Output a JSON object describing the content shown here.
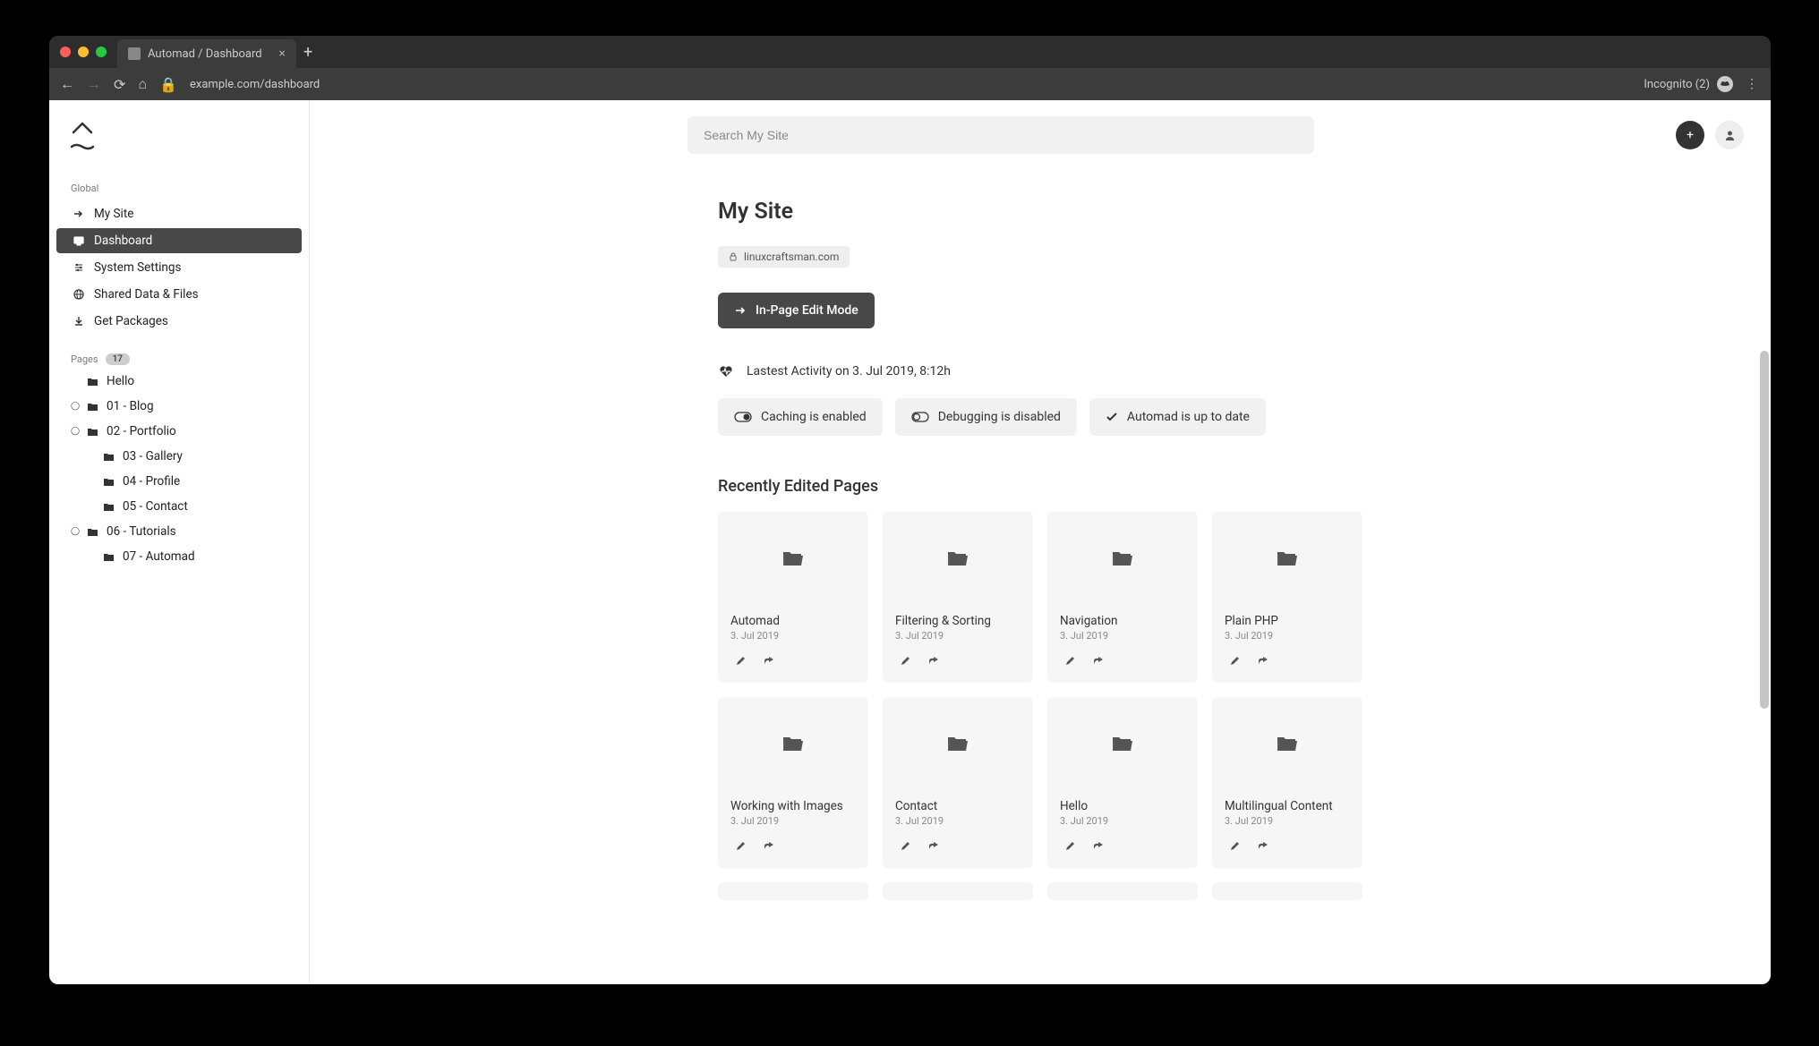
{
  "browser": {
    "tab_title": "Automad / Dashboard",
    "url": "example.com/dashboard",
    "incognito_label": "Incognito (2)"
  },
  "sidebar": {
    "global_label": "Global",
    "items": [
      {
        "icon": "arrow",
        "label": "My Site"
      },
      {
        "icon": "monitor",
        "label": "Dashboard"
      },
      {
        "icon": "sliders",
        "label": "System Settings"
      },
      {
        "icon": "globe",
        "label": "Shared Data & Files"
      },
      {
        "icon": "download",
        "label": "Get Packages"
      }
    ],
    "pages_label": "Pages",
    "pages_count": "17",
    "tree": [
      {
        "depth": 1,
        "expand": false,
        "label": "Hello"
      },
      {
        "depth": 1,
        "expand": true,
        "label": "01 - Blog"
      },
      {
        "depth": 1,
        "expand": true,
        "label": "02 - Portfolio"
      },
      {
        "depth": 2,
        "expand": false,
        "label": "03 - Gallery"
      },
      {
        "depth": 2,
        "expand": false,
        "label": "04 - Profile"
      },
      {
        "depth": 2,
        "expand": false,
        "label": "05 - Contact"
      },
      {
        "depth": 1,
        "expand": true,
        "label": "06 - Tutorials"
      },
      {
        "depth": 2,
        "expand": false,
        "label": "07 - Automad"
      }
    ]
  },
  "header": {
    "search_placeholder": "Search My Site"
  },
  "site": {
    "title": "My Site",
    "url": "linuxcraftsman.com",
    "edit_button": "In-Page Edit Mode",
    "activity": "Lastest Activity on 3. Jul 2019, 8:12h"
  },
  "status": {
    "caching": "Caching is enabled",
    "debugging": "Debugging is disabled",
    "update": "Automad is up to date"
  },
  "recent": {
    "title": "Recently Edited Pages",
    "cards": [
      {
        "title": "Automad",
        "date": "3. Jul 2019"
      },
      {
        "title": "Filtering & Sorting",
        "date": "3. Jul 2019"
      },
      {
        "title": "Navigation",
        "date": "3. Jul 2019"
      },
      {
        "title": "Plain PHP",
        "date": "3. Jul 2019"
      },
      {
        "title": "Working with Images",
        "date": "3. Jul 2019"
      },
      {
        "title": "Contact",
        "date": "3. Jul 2019"
      },
      {
        "title": "Hello",
        "date": "3. Jul 2019"
      },
      {
        "title": "Multilingual Content",
        "date": "3. Jul 2019"
      }
    ]
  }
}
